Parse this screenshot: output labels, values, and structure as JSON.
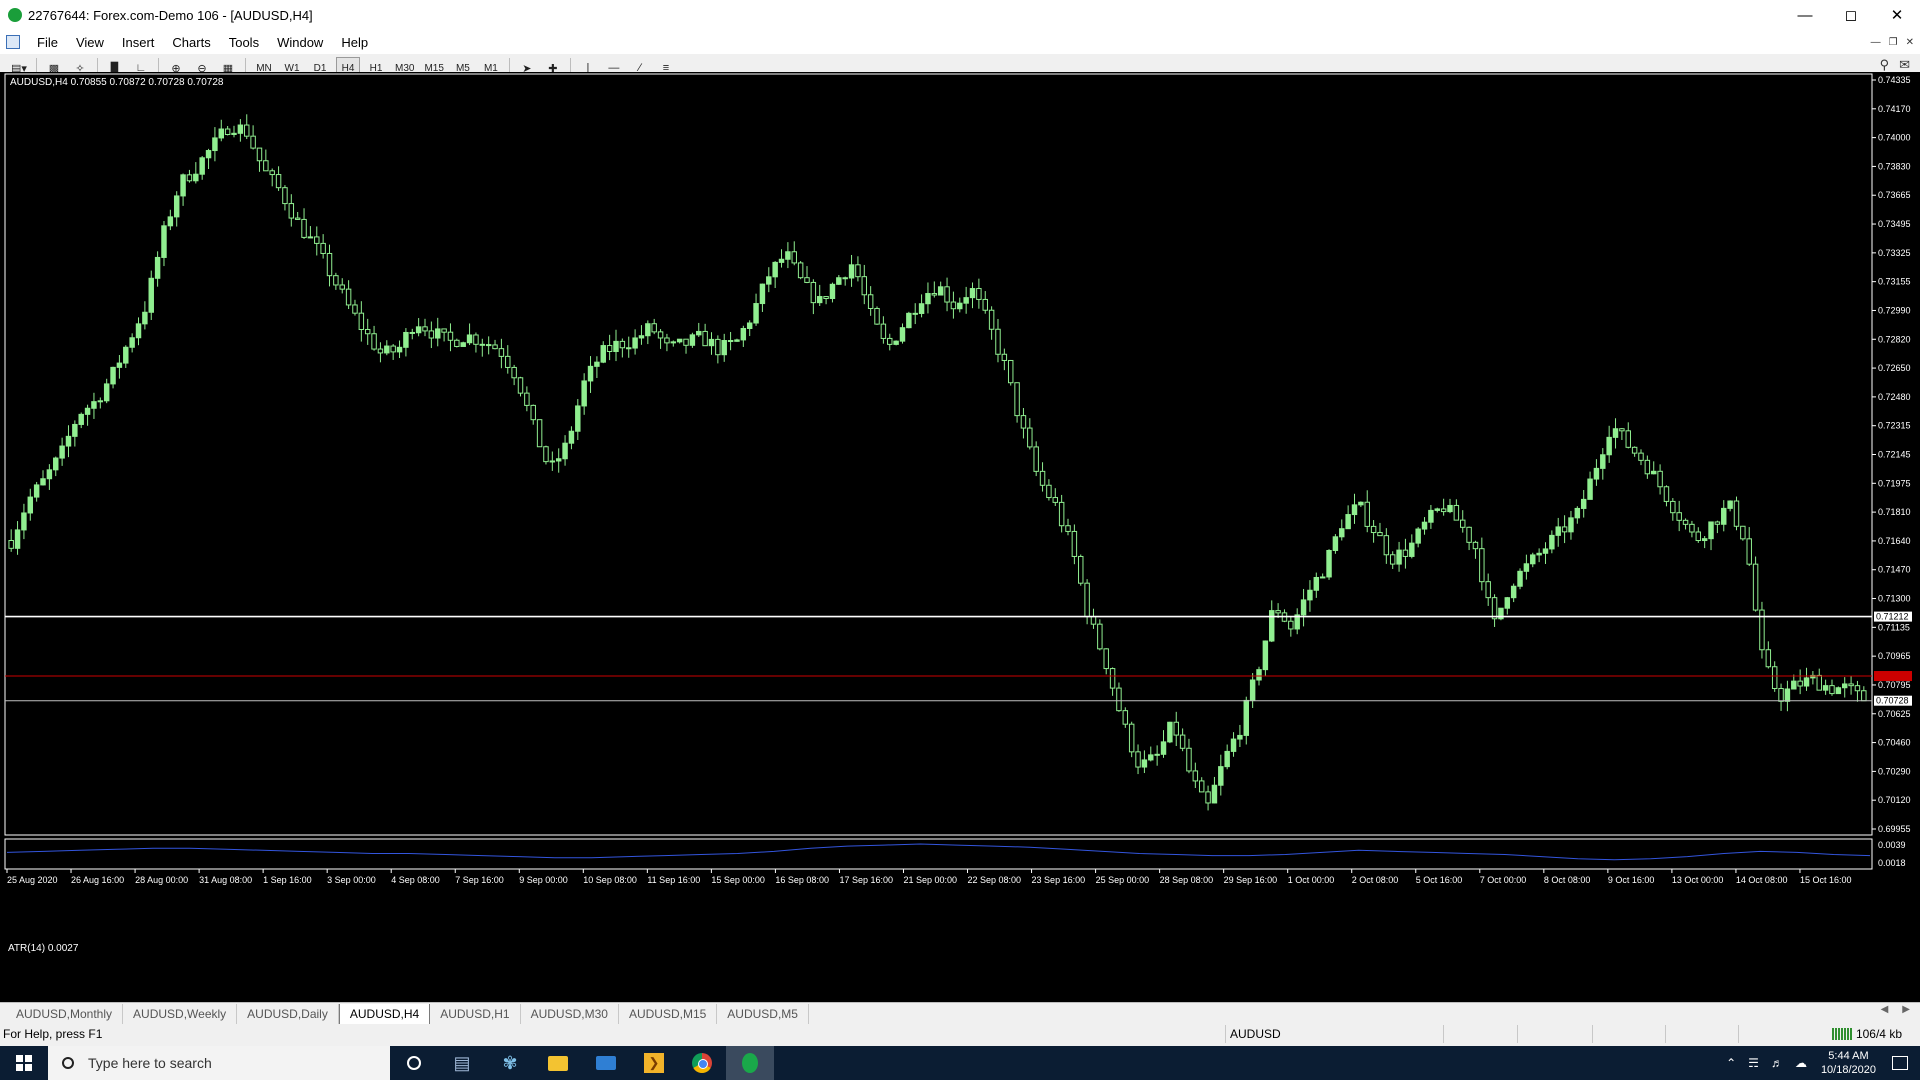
{
  "window": {
    "title": "22767644: Forex.com-Demo 106 - [AUDUSD,H4]"
  },
  "menu": [
    "File",
    "View",
    "Insert",
    "Charts",
    "Tools",
    "Window",
    "Help"
  ],
  "toolbar": {
    "timeframes": [
      "MN",
      "W1",
      "D1",
      "H4",
      "H1",
      "M30",
      "M15",
      "M5",
      "M1"
    ],
    "active_timeframe": "H4",
    "icons": [
      "new-chart-icon",
      "profiles-icon",
      "market-watch-icon",
      "navigator-icon",
      "bar-chart-icon",
      "candlestick-icon",
      "zoom-in-icon",
      "zoom-out-icon",
      "tile-windows-icon",
      "cursor-icon",
      "crosshair-icon",
      "vertical-line-icon",
      "horizontal-line-icon",
      "trendline-icon",
      "fibo-icon",
      "search-icon",
      "chat-icon"
    ]
  },
  "chart": {
    "ohlc_label": "AUDUSD,H4  0.70855 0.70872 0.70728 0.70728",
    "indicator_label": "ATR(14) 0.0027",
    "bull_color": "#90ee90",
    "bear_color": "#000000",
    "background": "#000000",
    "price_ticks": [
      "0.74335",
      "0.74170",
      "0.74000",
      "0.73830",
      "0.73665",
      "0.73495",
      "0.73325",
      "0.73155",
      "0.72990",
      "0.72820",
      "0.72650",
      "0.72480",
      "0.72315",
      "0.72145",
      "0.71975",
      "0.71810",
      "0.71640",
      "0.71470",
      "0.71300",
      "0.71135",
      "0.70965",
      "0.70795",
      "0.70625",
      "0.70460",
      "0.70290",
      "0.70120",
      "0.69955"
    ],
    "atr_ticks": [
      "0.0039",
      "0.0018"
    ],
    "time_labels": [
      "25 Aug 2020",
      "26 Aug 16:00",
      "28 Aug 00:00",
      "31 Aug 08:00",
      "1 Sep 16:00",
      "3 Sep 00:00",
      "4 Sep 08:00",
      "7 Sep 16:00",
      "9 Sep 00:00",
      "10 Sep 08:00",
      "11 Sep 16:00",
      "15 Sep 00:00",
      "16 Sep 08:00",
      "17 Sep 16:00",
      "21 Sep 00:00",
      "22 Sep 08:00",
      "23 Sep 16:00",
      "25 Sep 00:00",
      "28 Sep 08:00",
      "29 Sep 16:00",
      "1 Oct 00:00",
      "2 Oct 08:00",
      "5 Oct 16:00",
      "7 Oct 00:00",
      "8 Oct 08:00",
      "9 Oct 16:00",
      "13 Oct 00:00",
      "14 Oct 08:00",
      "15 Oct 16:00"
    ],
    "hlines": [
      {
        "price": 0.71212,
        "label": "0.71212",
        "color": "#ffffff"
      },
      {
        "price": 0.7087,
        "label": "0.70870",
        "color": "#cc0000"
      },
      {
        "price": 0.70728,
        "label": "0.70728",
        "color": "#c0c0c0"
      }
    ],
    "ylim": [
      0.69955,
      0.74335
    ],
    "price_path": [
      0.7165,
      0.7188,
      0.72,
      0.7215,
      0.7238,
      0.7245,
      0.726,
      0.728,
      0.73,
      0.734,
      0.737,
      0.738,
      0.7392,
      0.7405,
      0.74,
      0.7378,
      0.7366,
      0.7348,
      0.7335,
      0.7318,
      0.73,
      0.7285,
      0.7272,
      0.7275,
      0.7292,
      0.7285,
      0.7279,
      0.7283,
      0.728,
      0.7275,
      0.726,
      0.723,
      0.7205,
      0.722,
      0.7255,
      0.7272,
      0.7278,
      0.728,
      0.7288,
      0.7275,
      0.7278,
      0.7282,
      0.7275,
      0.7278,
      0.7295,
      0.7318,
      0.733,
      0.7312,
      0.7302,
      0.7315,
      0.7325,
      0.7295,
      0.7275,
      0.729,
      0.7305,
      0.7312,
      0.73,
      0.731,
      0.729,
      0.7265,
      0.723,
      0.72,
      0.7185,
      0.716,
      0.712,
      0.7095,
      0.706,
      0.7035,
      0.704,
      0.706,
      0.703,
      0.701,
      0.7038,
      0.7058,
      0.709,
      0.7128,
      0.7115,
      0.7135,
      0.715,
      0.7175,
      0.7185,
      0.717,
      0.7155,
      0.716,
      0.7175,
      0.7185,
      0.7175,
      0.716,
      0.7115,
      0.714,
      0.715,
      0.716,
      0.717,
      0.718,
      0.7205,
      0.7232,
      0.722,
      0.721,
      0.7195,
      0.718,
      0.7165,
      0.7175,
      0.7185,
      0.7165,
      0.7095,
      0.7075,
      0.7082,
      0.7085,
      0.708,
      0.708,
      0.70728
    ],
    "atr_path": [
      0.003,
      0.0031,
      0.0032,
      0.0033,
      0.0034,
      0.0034,
      0.0033,
      0.0032,
      0.0031,
      0.003,
      0.0029,
      0.0029,
      0.0028,
      0.0027,
      0.0026,
      0.0025,
      0.0025,
      0.0026,
      0.0027,
      0.0028,
      0.0029,
      0.0031,
      0.0034,
      0.0036,
      0.0037,
      0.0038,
      0.0037,
      0.0036,
      0.0035,
      0.0033,
      0.0031,
      0.0029,
      0.0028,
      0.0027,
      0.0027,
      0.0028,
      0.003,
      0.0032,
      0.0031,
      0.003,
      0.0029,
      0.0028,
      0.0026,
      0.0024,
      0.0023,
      0.0024,
      0.0026,
      0.0029,
      0.0031,
      0.003,
      0.0028,
      0.0027
    ]
  },
  "tabs": [
    "AUDUSD,Monthly",
    "AUDUSD,Weekly",
    "AUDUSD,Daily",
    "AUDUSD,H4",
    "AUDUSD,H1",
    "AUDUSD,M30",
    "AUDUSD,M15",
    "AUDUSD,M5"
  ],
  "active_tab": "AUDUSD,H4",
  "status": {
    "help": "For Help, press F1",
    "symbol": "AUDUSD",
    "traffic": "106/4 kb"
  },
  "taskbar": {
    "search_placeholder": "Type here to search",
    "time": "5:44 AM",
    "date": "10/18/2020",
    "icons": [
      "windows-start-icon",
      "cortana-icon",
      "task-view-icon",
      "paint-icon",
      "file-explorer-icon",
      "remote-desktop-icon",
      "powerpoint-icon",
      "chrome-icon",
      "metatrader-icon"
    ]
  }
}
